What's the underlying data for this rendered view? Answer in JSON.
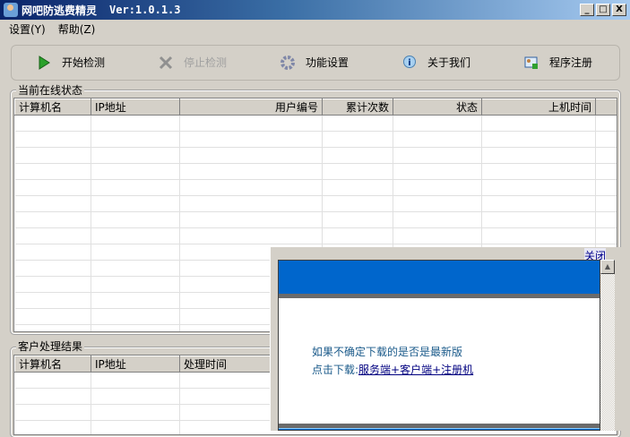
{
  "window": {
    "title": "网吧防逃费精灵",
    "version": "Ver:1.0.1.3",
    "min": "_",
    "max": "□",
    "close": "X"
  },
  "menu": [
    "设置(Y)",
    "帮助(Z)"
  ],
  "toolbar": {
    "start": "开始检测",
    "stop": "停止检测",
    "settings": "功能设置",
    "about": "关于我们",
    "register": "程序注册"
  },
  "online": {
    "label": "当前在线状态",
    "columns": [
      "计算机名",
      "IP地址",
      "用户编号",
      "累计次数",
      "状态",
      "上机时间"
    ]
  },
  "results": {
    "label": "客户处理结果",
    "columns": [
      "计算机名",
      "IP地址",
      "处理时间"
    ]
  },
  "popup": {
    "close": "关闭",
    "line1": "如果不确定下载的是否是最新版",
    "line2_prefix": "点击下载:",
    "link": "服务端+客户端+注册机",
    "scroll_up": "▲"
  }
}
